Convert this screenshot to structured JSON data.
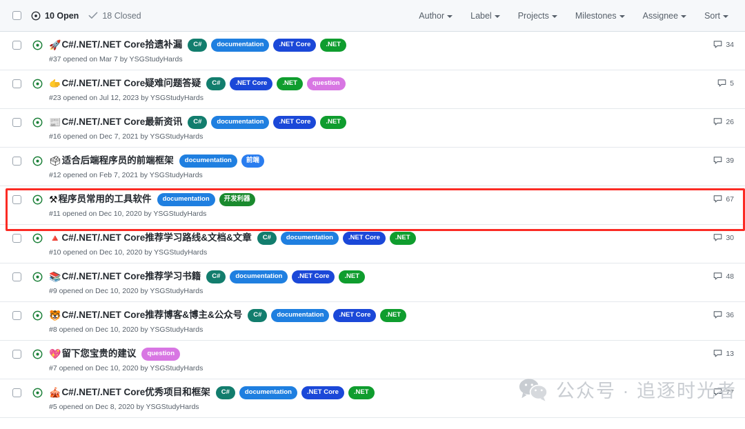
{
  "header": {
    "select_all_checkbox": "select-all",
    "open_count_label": "10 Open",
    "closed_count_label": "18 Closed",
    "filters": [
      {
        "label": "Author"
      },
      {
        "label": "Label"
      },
      {
        "label": "Projects"
      },
      {
        "label": "Milestones"
      },
      {
        "label": "Assignee"
      },
      {
        "label": "Sort"
      }
    ]
  },
  "colors": {
    "csharp_label": "#127d6d",
    "documentation_label": "#1f7fe0",
    "netcore_label": "#1b48d8",
    "net_label": "#0f9d2e",
    "question_label": "#d876e3",
    "frontend_label": "#2a7def",
    "devtool_label": "#1a8a2e",
    "open_icon": "#1a7f37",
    "highlight_box": "#fb2b24",
    "header_bg": "#f6f8fa",
    "watermark": "#c9cdd2"
  },
  "issues": [
    {
      "emoji": "🚀",
      "title": "C#/.NET/.NET Core拾遗补漏",
      "meta": "#37 opened on Mar 7 by YSGStudyHards",
      "comments": "34",
      "highlighted": false,
      "labels": [
        {
          "text": "C#",
          "color": "#127d6d",
          "cjk": false
        },
        {
          "text": "documentation",
          "color": "#1f7fe0",
          "cjk": false
        },
        {
          "text": ".NET Core",
          "color": "#1b48d8",
          "cjk": false
        },
        {
          "text": ".NET",
          "color": "#0f9d2e",
          "cjk": false
        }
      ]
    },
    {
      "emoji": "🫱",
      "title": "C#/.NET/.NET Core疑难问题答疑",
      "meta": "#23 opened on Jul 12, 2023 by YSGStudyHards",
      "comments": "5",
      "highlighted": false,
      "labels": [
        {
          "text": "C#",
          "color": "#127d6d",
          "cjk": false
        },
        {
          "text": ".NET Core",
          "color": "#1b48d8",
          "cjk": false
        },
        {
          "text": ".NET",
          "color": "#0f9d2e",
          "cjk": false
        },
        {
          "text": "question",
          "color": "#d876e3",
          "cjk": false
        }
      ]
    },
    {
      "emoji": "📰",
      "title": "C#/.NET/.NET Core最新资讯",
      "meta": "#16 opened on Dec 7, 2021 by YSGStudyHards",
      "comments": "26",
      "highlighted": false,
      "labels": [
        {
          "text": "C#",
          "color": "#127d6d",
          "cjk": false
        },
        {
          "text": "documentation",
          "color": "#1f7fe0",
          "cjk": false
        },
        {
          "text": ".NET Core",
          "color": "#1b48d8",
          "cjk": false
        },
        {
          "text": ".NET",
          "color": "#0f9d2e",
          "cjk": false
        }
      ]
    },
    {
      "emoji": "🗳",
      "title": "适合后端程序员的前端框架",
      "meta": "#12 opened on Feb 7, 2021 by YSGStudyHards",
      "comments": "39",
      "highlighted": false,
      "labels": [
        {
          "text": "documentation",
          "color": "#1f7fe0",
          "cjk": false
        },
        {
          "text": "前端",
          "color": "#2a7def",
          "cjk": true
        }
      ]
    },
    {
      "emoji": "⚒",
      "title": "程序员常用的工具软件",
      "meta": "#11 opened on Dec 10, 2020 by YSGStudyHards",
      "comments": "67",
      "highlighted": true,
      "labels": [
        {
          "text": "documentation",
          "color": "#1f7fe0",
          "cjk": false
        },
        {
          "text": "开发利器",
          "color": "#1a8a2e",
          "cjk": true
        }
      ]
    },
    {
      "emoji": "🔺",
      "title": "C#/.NET/.NET Core推荐学习路线&文档&文章",
      "meta": "#10 opened on Dec 10, 2020 by YSGStudyHards",
      "comments": "30",
      "highlighted": false,
      "labels": [
        {
          "text": "C#",
          "color": "#127d6d",
          "cjk": false
        },
        {
          "text": "documentation",
          "color": "#1f7fe0",
          "cjk": false
        },
        {
          "text": ".NET Core",
          "color": "#1b48d8",
          "cjk": false
        },
        {
          "text": ".NET",
          "color": "#0f9d2e",
          "cjk": false
        }
      ]
    },
    {
      "emoji": "📚",
      "title": "C#/.NET/.NET Core推荐学习书籍",
      "meta": "#9 opened on Dec 10, 2020 by YSGStudyHards",
      "comments": "48",
      "highlighted": false,
      "labels": [
        {
          "text": "C#",
          "color": "#127d6d",
          "cjk": false
        },
        {
          "text": "documentation",
          "color": "#1f7fe0",
          "cjk": false
        },
        {
          "text": ".NET Core",
          "color": "#1b48d8",
          "cjk": false
        },
        {
          "text": ".NET",
          "color": "#0f9d2e",
          "cjk": false
        }
      ]
    },
    {
      "emoji": "🐯",
      "title": "C#/.NET/.NET Core推荐博客&博主&公众号",
      "meta": "#8 opened on Dec 10, 2020 by YSGStudyHards",
      "comments": "36",
      "highlighted": false,
      "labels": [
        {
          "text": "C#",
          "color": "#127d6d",
          "cjk": false
        },
        {
          "text": "documentation",
          "color": "#1f7fe0",
          "cjk": false
        },
        {
          "text": ".NET Core",
          "color": "#1b48d8",
          "cjk": false
        },
        {
          "text": ".NET",
          "color": "#0f9d2e",
          "cjk": false
        }
      ]
    },
    {
      "emoji": "💖",
      "title": "留下您宝贵的建议",
      "meta": "#7 opened on Dec 10, 2020 by YSGStudyHards",
      "comments": "13",
      "highlighted": false,
      "labels": [
        {
          "text": "question",
          "color": "#d876e3",
          "cjk": false
        }
      ]
    },
    {
      "emoji": "🎪",
      "title": "C#/.NET/.NET Core优秀项目和框架",
      "meta": "#5 opened on Dec 8, 2020 by YSGStudyHards",
      "comments": "77",
      "highlighted": false,
      "labels": [
        {
          "text": "C#",
          "color": "#127d6d",
          "cjk": false
        },
        {
          "text": "documentation",
          "color": "#1f7fe0",
          "cjk": false
        },
        {
          "text": ".NET Core",
          "color": "#1b48d8",
          "cjk": false
        },
        {
          "text": ".NET",
          "color": "#0f9d2e",
          "cjk": false
        }
      ]
    }
  ],
  "watermark": {
    "text": "公众号 · 追逐时光者",
    "logo": "wechat-icon"
  }
}
